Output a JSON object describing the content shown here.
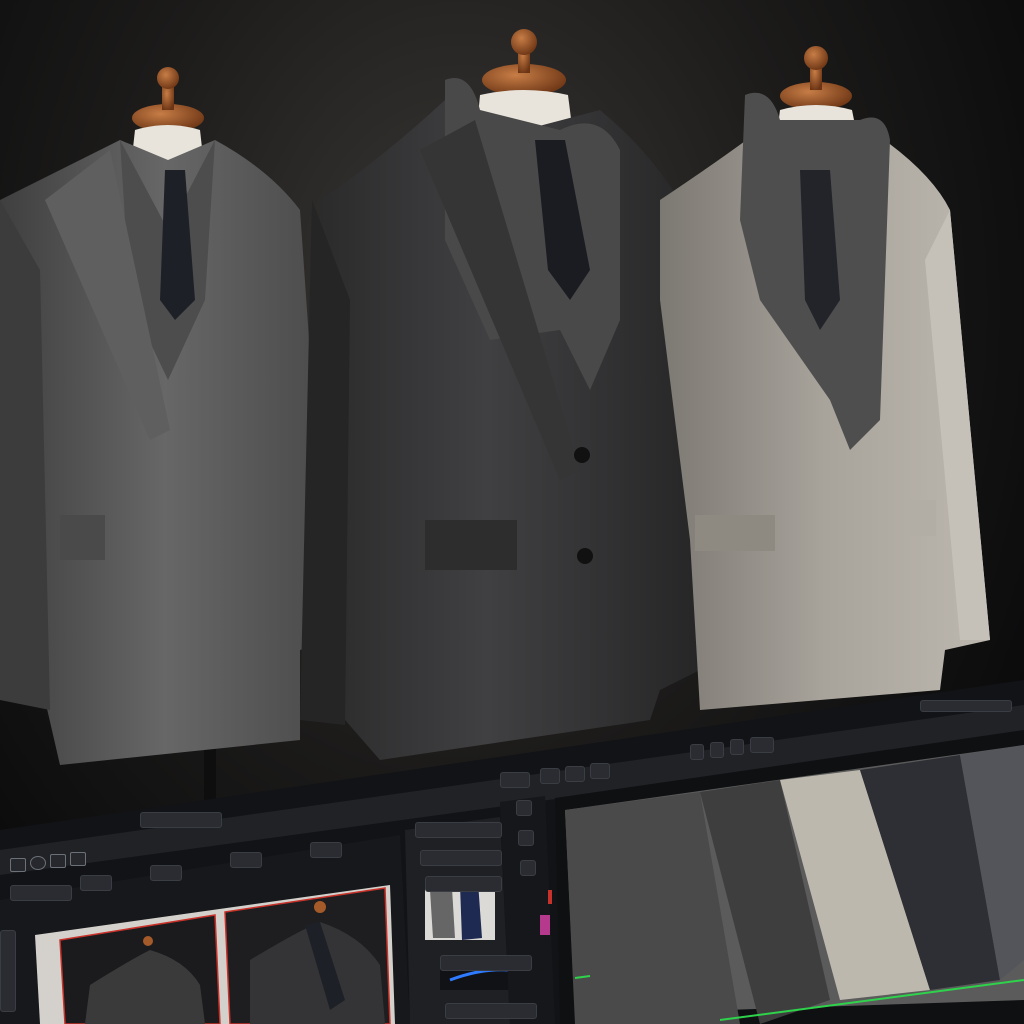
{
  "scene": {
    "description_free": true
  },
  "colors": {
    "background": "#0c0c0d",
    "ui_dark": "#1c1d20",
    "accent_red": "#c8322a",
    "accent_blue": "#2f7bff",
    "accent_green": "#2fd24b"
  },
  "mannequins": [
    {
      "coat_color": "#5a5a5a",
      "scarf": false
    },
    {
      "coat_color": "#3a3a3b",
      "scarf": true
    },
    {
      "coat_color": "#9a958e",
      "scarf": true
    }
  ],
  "editor": {
    "toolbar_icons": [
      "square-icon",
      "circle-icon",
      "arrow-icon"
    ],
    "thumbnails": 2
  }
}
